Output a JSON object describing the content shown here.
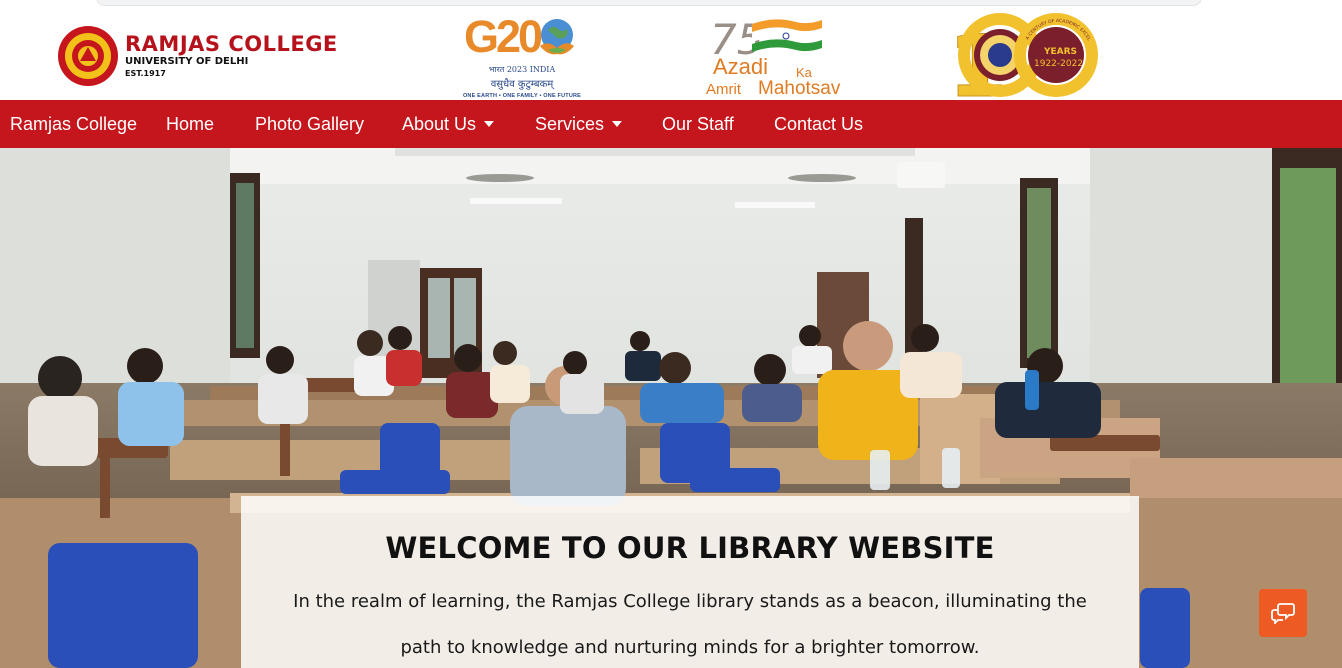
{
  "header": {
    "ramjas": {
      "name": "RAMJAS COLLEGE",
      "university": "UNIVERSITY OF DELHI",
      "established": "EST.1917"
    },
    "g20": {
      "title": "G20",
      "line1": "भारत 2023 INDIA",
      "line2": "वसुधैव कुटुम्बकम्",
      "tagline": "ONE EARTH • ONE FAMILY • ONE FUTURE"
    },
    "azadi": {
      "number": "75",
      "word1": "Azadi",
      "word2": "Ka",
      "word3": "Amrit",
      "word4": "Mahotsav"
    },
    "centenary": {
      "arc_text": "A CENTURY OF ACADEMIC EXCELLENCE",
      "years_label": "YEARS",
      "years_range": "1922-2022"
    }
  },
  "nav": {
    "brand": "Ramjas College",
    "items": [
      {
        "label": "Home",
        "dropdown": false
      },
      {
        "label": "Photo Gallery",
        "dropdown": false
      },
      {
        "label": "About Us",
        "dropdown": true
      },
      {
        "label": "Services",
        "dropdown": true
      },
      {
        "label": "Our Staff",
        "dropdown": false
      },
      {
        "label": "Contact Us",
        "dropdown": false
      }
    ]
  },
  "hero": {
    "title": "WELCOME TO OUR LIBRARY WEBSITE",
    "text": "In the realm of learning, the Ramjas College library stands as a beacon, illuminating the path to knowledge and nurturing minds for a brighter tomorrow."
  },
  "icons": {
    "chat": "chat-bubbles-icon"
  },
  "colors": {
    "navbar": "#c4161c",
    "brand_red": "#b5121b",
    "chat_button": "#ee5a24",
    "saffron": "#e07b22"
  }
}
